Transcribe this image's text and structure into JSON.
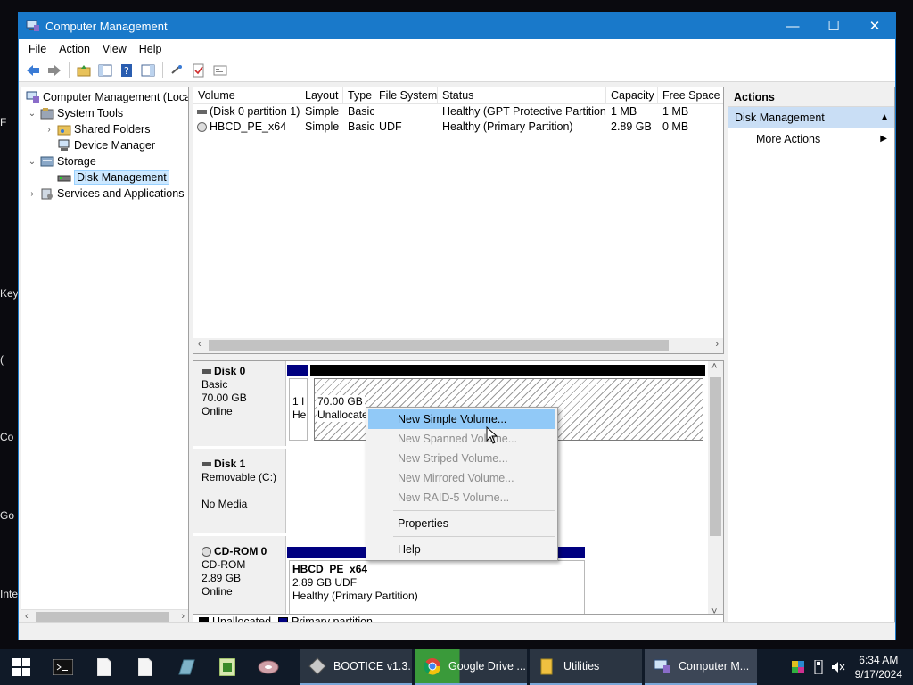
{
  "desktop_fragments": [
    "F",
    "Key",
    "(",
    "Co",
    "Go",
    "Inte"
  ],
  "window": {
    "title": "Computer Management",
    "minimize": "—",
    "maximize": "☐",
    "close": "✕"
  },
  "menu": [
    "File",
    "Action",
    "View",
    "Help"
  ],
  "tree": [
    {
      "label": "Computer Management (Local",
      "level": 0,
      "expander": "",
      "icon": "computer-management-icon"
    },
    {
      "label": "System Tools",
      "level": 1,
      "expander": "⌄",
      "icon": "system-tools-icon"
    },
    {
      "label": "Shared Folders",
      "level": 2,
      "expander": "›",
      "icon": "shared-folders-icon"
    },
    {
      "label": "Device Manager",
      "level": 2,
      "expander": "",
      "icon": "device-manager-icon"
    },
    {
      "label": "Storage",
      "level": 1,
      "expander": "⌄",
      "icon": "storage-icon"
    },
    {
      "label": "Disk Management",
      "level": 2,
      "expander": "",
      "icon": "disk-management-icon",
      "selected": true
    },
    {
      "label": "Services and Applications",
      "level": 1,
      "expander": "›",
      "icon": "services-icon"
    }
  ],
  "volumes": {
    "columns": [
      "Volume",
      "Layout",
      "Type",
      "File System",
      "Status",
      "Capacity",
      "Free Space"
    ],
    "rows": [
      [
        "(Disk 0 partition 1)",
        "Simple",
        "Basic",
        "",
        "Healthy (GPT Protective Partition)",
        "1 MB",
        "1 MB"
      ],
      [
        "HBCD_PE_x64",
        "Simple",
        "Basic",
        "UDF",
        "Healthy (Primary Partition)",
        "2.89 GB",
        "0 MB"
      ]
    ]
  },
  "disks": {
    "disk0": {
      "name": "Disk 0",
      "type": "Basic",
      "size": "70.00 GB",
      "state": "Online",
      "part1_line1": "1 I",
      "part1_line2": "He",
      "part2_size": "70.00 GB",
      "part2_status": "Unallocate"
    },
    "disk1": {
      "name": "Disk 1",
      "type": "Removable (C:)",
      "state": "No Media"
    },
    "cdrom0": {
      "name": "CD-ROM 0",
      "type": "CD-ROM",
      "size": "2.89 GB",
      "state": "Online",
      "part_name": "HBCD_PE_x64",
      "part_size": "2.89 GB UDF",
      "part_status": "Healthy (Primary Partition)"
    }
  },
  "legend": {
    "unallocated": "Unallocated",
    "primary": "Primary partition"
  },
  "actions": {
    "header": "Actions",
    "section": "Disk Management",
    "more": "More Actions"
  },
  "context_menu": [
    {
      "label": "New Simple Volume...",
      "state": "highlighted"
    },
    {
      "label": "New Spanned Volume...",
      "state": "disabled"
    },
    {
      "label": "New Striped Volume...",
      "state": "disabled"
    },
    {
      "label": "New Mirrored Volume...",
      "state": "disabled"
    },
    {
      "label": "New RAID-5 Volume...",
      "state": "disabled"
    },
    {
      "label": "Properties",
      "state": "enabled"
    },
    {
      "label": "Help",
      "state": "enabled"
    }
  ],
  "taskbar": {
    "apps": [
      "BOOTICE v1.3...",
      "Google Drive ...",
      "Utilities",
      "Computer M..."
    ],
    "time": "6:34 AM",
    "date": "9/17/2024"
  },
  "colors": {
    "titlebar": "#1979ca",
    "unallocated": "#000000",
    "primary": "#000080",
    "highlight": "#91c9f7"
  }
}
